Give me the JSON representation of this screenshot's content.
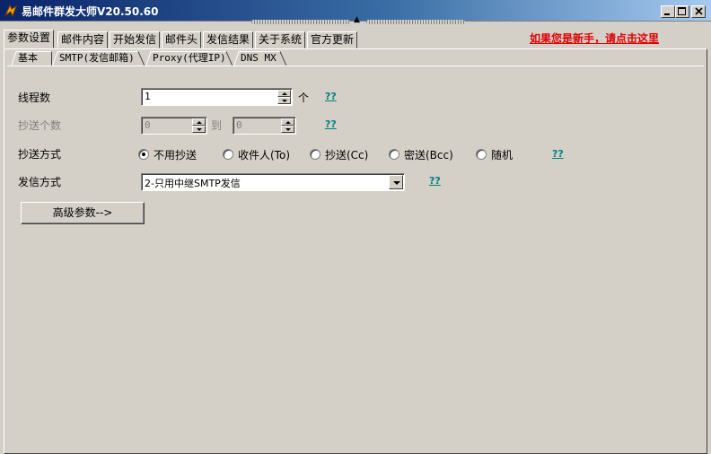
{
  "window": {
    "title": "易邮件群发大师V20.50.60",
    "buttons": [
      "minimize",
      "maximize",
      "close"
    ]
  },
  "main_tabs": [
    {
      "label": "参数设置",
      "active": true
    },
    {
      "label": "邮件内容",
      "active": false
    },
    {
      "label": "开始发信",
      "active": false
    },
    {
      "label": "邮件头",
      "active": false
    },
    {
      "label": "发信结果",
      "active": false
    },
    {
      "label": "关于系统",
      "active": false
    },
    {
      "label": "官方更新",
      "active": false
    }
  ],
  "newbie_link": "如果您是新手，请点击这里",
  "sub_tabs": [
    {
      "label": "基本",
      "active": true
    },
    {
      "label": "SMTP(发信邮箱)",
      "active": false
    },
    {
      "label": "Proxy(代理IP)",
      "active": false
    },
    {
      "label": "DNS MX",
      "active": false
    }
  ],
  "form": {
    "threads": {
      "label": "线程数",
      "value": "1",
      "unit": "个",
      "help": "??"
    },
    "cc_count": {
      "label": "抄送个数",
      "from": "0",
      "to_word": "到",
      "to": "0",
      "help": "??",
      "disabled": true
    },
    "cc_mode": {
      "label": "抄送方式",
      "options": [
        "不用抄送",
        "收件人(To)",
        "抄送(Cc)",
        "密送(Bcc)",
        "随机"
      ],
      "selected": "不用抄送",
      "help": "??"
    },
    "send_mode": {
      "label": "发信方式",
      "value": "2-只用中继SMTP发信",
      "help": "??"
    },
    "advanced_button": "高级参数-->"
  },
  "colors": {
    "titlebar_start": "#0a246a",
    "titlebar_end": "#a6caf0",
    "face": "#d4d0c8",
    "newbie_link": "#e00000",
    "help_link": "#008080"
  }
}
